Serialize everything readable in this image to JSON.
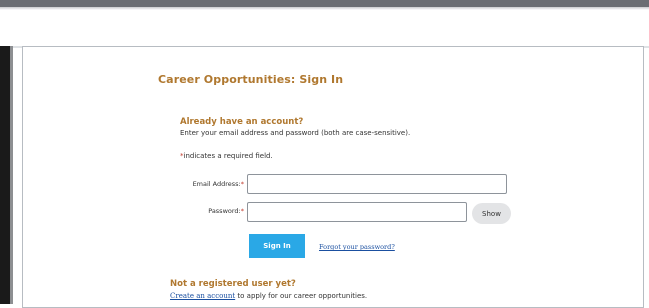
{
  "page": {
    "title": "Career Opportunities: Sign In"
  },
  "signin": {
    "heading": "Already have an account?",
    "instructions": "Enter your email address and password (both are case-sensitive).",
    "required_star": "*",
    "required_note": "indicates a required field.",
    "email_label": "Email Address:",
    "email_value": "",
    "password_label": "Password:",
    "password_value": "",
    "show_label": "Show",
    "submit_label": "Sign In",
    "forgot_link": "Forgot your password?"
  },
  "register": {
    "heading": "Not a registered user yet?",
    "create_link": "Create an account",
    "create_suffix": " to apply for our career opportunities."
  },
  "colors": {
    "heading": "#b0782f",
    "primary_button": "#2aa8e6",
    "link": "#1a4fa0",
    "required": "#c0392b"
  }
}
